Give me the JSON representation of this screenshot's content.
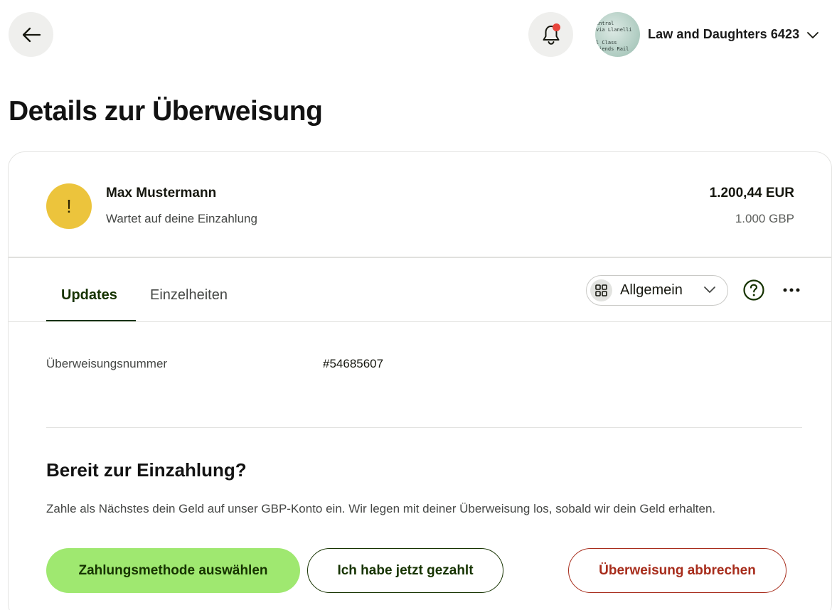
{
  "header": {
    "back_icon": "arrow-left-icon",
    "notification_icon": "bell-icon",
    "notification_badge_color": "#e8453c",
    "account_name": "Law and Daughters 6423",
    "avatar_lines": [
      "…",
      "entral",
      "via Llanelli",
      "",
      "l Class",
      "ciends Rail"
    ]
  },
  "page": {
    "title": "Details zur Überweisung"
  },
  "transfer": {
    "status_icon_glyph": "!",
    "status_color": "#ecc43c",
    "recipient_name": "Max Mustermann",
    "status_text": "Wartet auf deine Einzahlung",
    "amount_primary": "1.200,44 EUR",
    "amount_secondary": "1.000 GBP"
  },
  "tabs": [
    {
      "label": "Updates",
      "active": true
    },
    {
      "label": "Einzelheiten",
      "active": false
    }
  ],
  "filter": {
    "icon": "grid-icon",
    "label": "Allgemein"
  },
  "details": {
    "transfer_number_label": "Überweisungsnummer",
    "transfer_number_value": "#54685607"
  },
  "cta": {
    "title": "Bereit zur Einzahlung?",
    "text": "Zahle als Nächstes dein Geld auf unser GBP-Konto ein. Wir legen mit deiner Überweisung los, sobald wir dein Geld erhalten.",
    "primary_label": "Zahlungsmethode auswählen",
    "secondary_label": "Ich habe jetzt gezahlt",
    "cancel_label": "Überweisung abbrechen"
  },
  "colors": {
    "accent_green": "#9fe870",
    "dark_green": "#163300",
    "danger_red": "#a72c1b"
  }
}
